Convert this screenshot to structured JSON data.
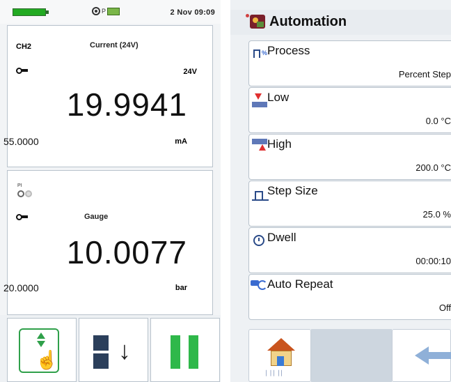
{
  "left_screen": {
    "status": {
      "date_time": "2 Nov 09:09",
      "battery_color": "#22aa22",
      "icons": [
        "sensor-icon",
        "pressure-link-icon"
      ],
      "indicator_text": "P"
    },
    "channel1": {
      "tag": "CH2",
      "function": "Current (24V)",
      "range": "24V",
      "reading": "19.9941",
      "secondary_value": "55.0000",
      "unit": "mA"
    },
    "channel2": {
      "tag": "PI",
      "function": "Gauge",
      "reading": "10.0077",
      "secondary_value": "20.0000",
      "unit": "bar"
    },
    "buttons": [
      {
        "name": "task-button",
        "icon": "task-hand-icon"
      },
      {
        "name": "view-button",
        "icon": "layout-down-icon"
      },
      {
        "name": "pause-button",
        "icon": "pause-icon"
      }
    ]
  },
  "right_screen": {
    "title": "Automation",
    "items": [
      {
        "label": "Process",
        "value": "Percent Step",
        "icon": "process-icon"
      },
      {
        "label": "Low",
        "value": "0.0 °C",
        "icon": "low-icon"
      },
      {
        "label": "High",
        "value": "200.0 °C",
        "icon": "high-icon"
      },
      {
        "label": "Step Size",
        "value": "25.0 %",
        "icon": "step-icon"
      },
      {
        "label": "Dwell",
        "value": "00:00:10",
        "icon": "dwell-icon"
      },
      {
        "label": "Auto Repeat",
        "value": "Off",
        "icon": "auto-repeat-icon"
      }
    ],
    "footer": {
      "home_mini": "⏐ ⏐⏐ ⏐⏐",
      "home_icon": "home-icon",
      "back_icon": "back-arrow-icon"
    }
  },
  "colors": {
    "accent_green": "#2fa04a",
    "pause_green": "#2fb84a",
    "alert_red": "#e03030",
    "nav_blue": "#2a4a88"
  }
}
